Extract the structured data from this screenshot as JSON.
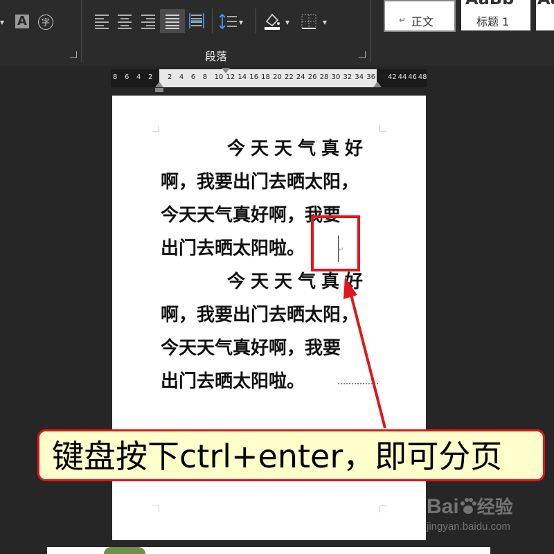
{
  "ribbon": {
    "font_group": {
      "char_shading_glyph": "A",
      "phonetic_glyph": "字"
    },
    "paragraph_group": {
      "label": "段落",
      "icons": [
        "align-left-icon",
        "align-center-icon",
        "align-right-icon",
        "justify-icon",
        "distributed-icon",
        "line-spacing-icon",
        "shading-icon",
        "borders-icon"
      ],
      "dropdown_glyph": "▾"
    },
    "styles": {
      "normal": "正文",
      "normal_mark": "↵",
      "heading1": "标题 1",
      "preview_text": "AaBb"
    }
  },
  "ruler": {
    "left_ticks": [
      "8",
      "6",
      "4",
      "2"
    ],
    "active_ticks": [
      "2",
      "4",
      "6",
      "8",
      "10",
      "12",
      "14",
      "16",
      "18",
      "20",
      "22",
      "24",
      "26",
      "28",
      "30",
      "32",
      "34",
      "36",
      "38"
    ],
    "right_ticks": [
      "42",
      "44",
      "46",
      "48"
    ]
  },
  "document": {
    "paragraph1": {
      "line1": "今天天气真好",
      "line2": "啊，我要出门去晒太阳，",
      "line3": "今天天气真好啊，我要",
      "line4": "出门去晒太阳啦。"
    },
    "paragraph2": {
      "line1": "今天天气真好",
      "line2": "啊，我要出门去晒太阳，",
      "line3": "今天天气真好啊，我要",
      "line4": "出门去晒太阳啦。"
    },
    "paragraph_mark": "↵"
  },
  "callout": {
    "text": "键盘按下ctrl+enter，即可分页"
  },
  "watermark": {
    "brand": "Bai",
    "brand_suffix": "经验",
    "url": "jingyan.baidu.com"
  },
  "colors": {
    "accent": "#e0161c",
    "callout_bg": "#ffffcc",
    "ribbon_bg": "#2b2b2b",
    "page_bg": "#ffffff"
  }
}
